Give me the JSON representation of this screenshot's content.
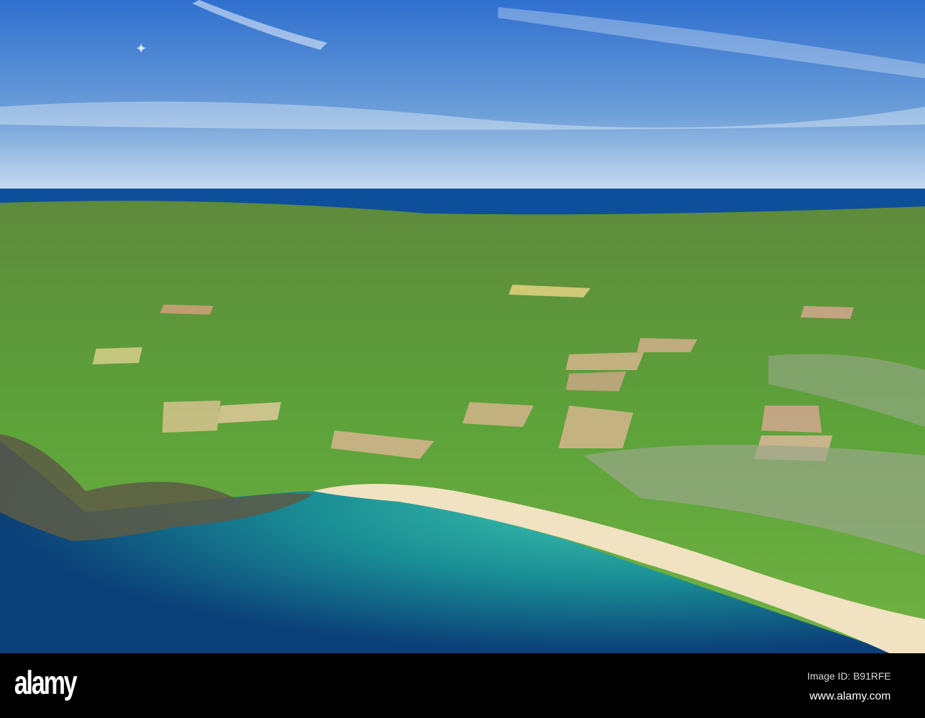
{
  "watermark": {
    "logo": "alamy",
    "image_id": "Image ID: B91RFE",
    "url": "www.alamy.com"
  },
  "colors": {
    "sky": "#3f7fd0",
    "sea_far": "#0d4f9a",
    "sea_near": "#0b3f78",
    "shallow": "#2fb0a0",
    "sand": "#f1e2c2",
    "field": "#5fa83a"
  }
}
